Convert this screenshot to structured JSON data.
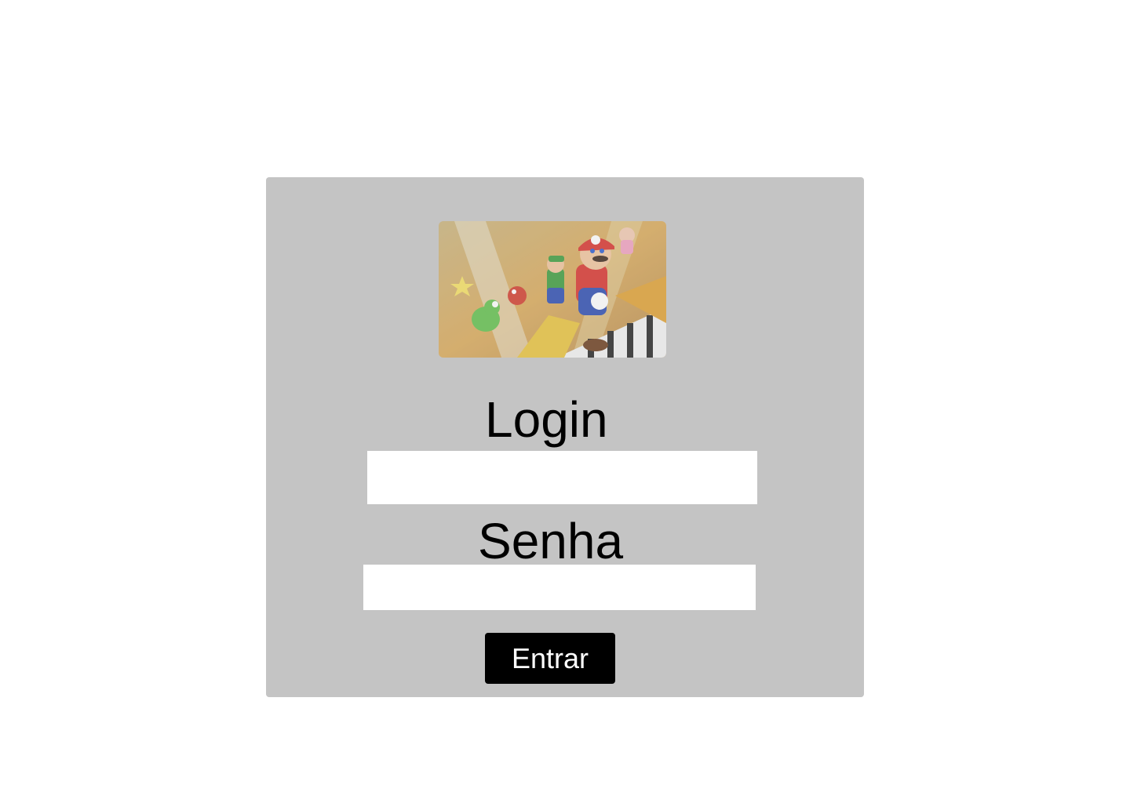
{
  "login_form": {
    "login_label": "Login",
    "login_value": "",
    "senha_label": "Senha",
    "senha_value": "",
    "submit_label": "Entrar"
  },
  "colors": {
    "page_background": "#ffffff",
    "card_background": "#c4c4c4",
    "input_background": "#ffffff",
    "button_background": "#000000",
    "button_text": "#ffffff"
  }
}
